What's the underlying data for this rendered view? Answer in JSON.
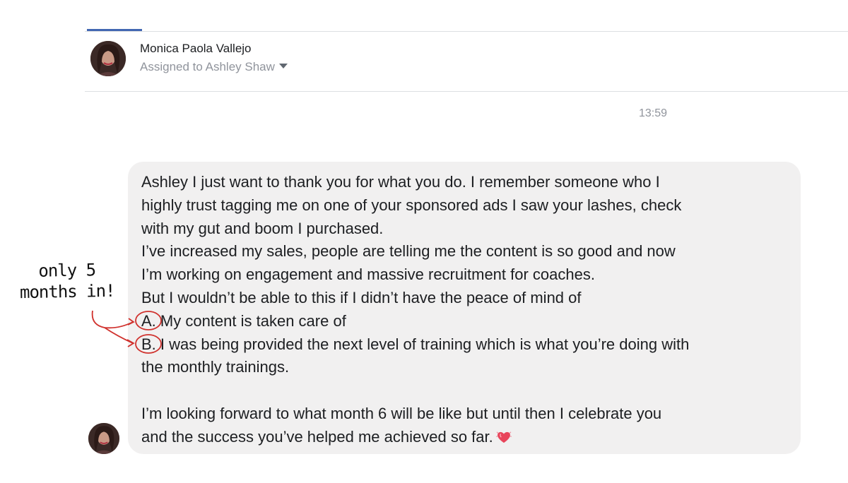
{
  "contact": {
    "name": "Monica Paola Vallejo",
    "assigned_to": "Assigned to Ashley Shaw"
  },
  "conversation": {
    "timestamp": "13:59",
    "message_lines": [
      "Ashley I just want to thank you for what you do. I remember someone who I",
      "highly trust tagging me on one of your sponsored ads I saw your lashes, check",
      "with my gut and boom I purchased.",
      "I’ve increased my sales, people are telling me the content is so good and now",
      "I’m working on engagement and massive recruitment for coaches.",
      "But I wouldn’t be able to this if I didn’t have the peace of mind of",
      "A.  My content is taken care of",
      "B. I was being provided the next level of training which is what you’re doing with",
      "the monthly trainings.",
      "",
      "I’m looking forward to what month 6 will be like but until then I celebrate you",
      "and the success you’ve helped me achieved so far."
    ],
    "emoji": "heart-emoji"
  },
  "annotation": {
    "line1": "only 5",
    "line2": "months in!",
    "color": "#d0312d"
  },
  "colors": {
    "accent": "#4267b2",
    "bubble": "#f1f0f0",
    "muted_text": "#90949c"
  }
}
